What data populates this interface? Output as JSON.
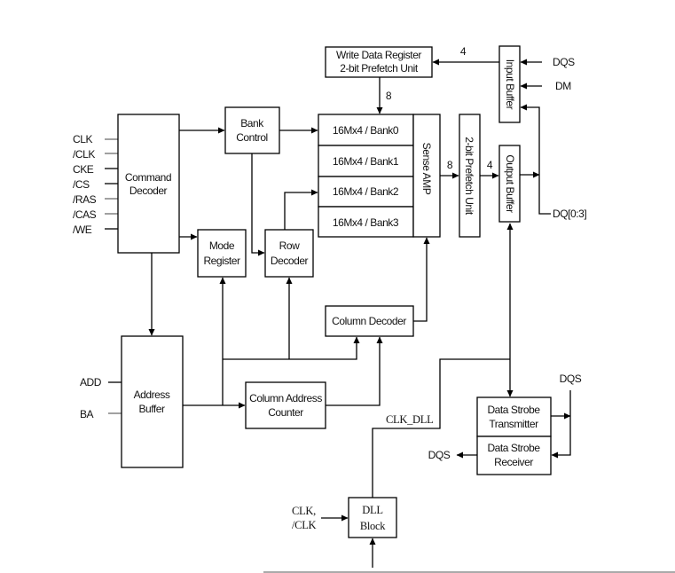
{
  "diagram": {
    "blocks": {
      "write_data_register": [
        "Write Data Register",
        "2-bit Prefetch Unit"
      ],
      "input_buffer": "Input Buffer",
      "output_buffer": "Output Buffer",
      "bank_control": [
        "Bank",
        "Control"
      ],
      "command_decoder": [
        "Command",
        "Decoder"
      ],
      "mode_register": [
        "Mode",
        "Register"
      ],
      "row_decoder": [
        "Row",
        "Decoder"
      ],
      "banks": [
        "16Mx4 / Bank0",
        "16Mx4 / Bank1",
        "16Mx4 / Bank2",
        "16Mx4 / Bank3"
      ],
      "sense_amp": "Sense AMP",
      "prefetch_unit": "2-bit Prefetch Unit",
      "column_decoder": "Column Decoder",
      "address_buffer": [
        "Address",
        "Buffer"
      ],
      "column_address_counter": [
        "Column Address",
        "Counter"
      ],
      "data_strobe_transmitter": [
        "Data Strobe",
        "Transmitter"
      ],
      "data_strobe_receiver": [
        "Data Strobe",
        "Receiver"
      ],
      "dll_block": [
        "DLL",
        "Block"
      ]
    },
    "signals": {
      "control_inputs": [
        "CLK",
        "/CLK",
        "CKE",
        "/CS",
        "/RAS",
        "/CAS",
        "/WE"
      ],
      "address_inputs": [
        "ADD",
        "BA"
      ],
      "dqs_input": "DQS",
      "dm_input": "DM",
      "dq": "DQ[0:3]",
      "dqs_strobe_top": "DQS",
      "dqs_strobe_out": "DQS",
      "clk_dll": "CLK_DLL",
      "dll_clock_inputs": [
        "CLK,",
        "/CLK"
      ]
    },
    "bus_widths": {
      "input_to_write_register": "4",
      "write_register_to_banks": "8",
      "sense_amp_to_prefetch": "8",
      "prefetch_to_output": "4"
    }
  }
}
